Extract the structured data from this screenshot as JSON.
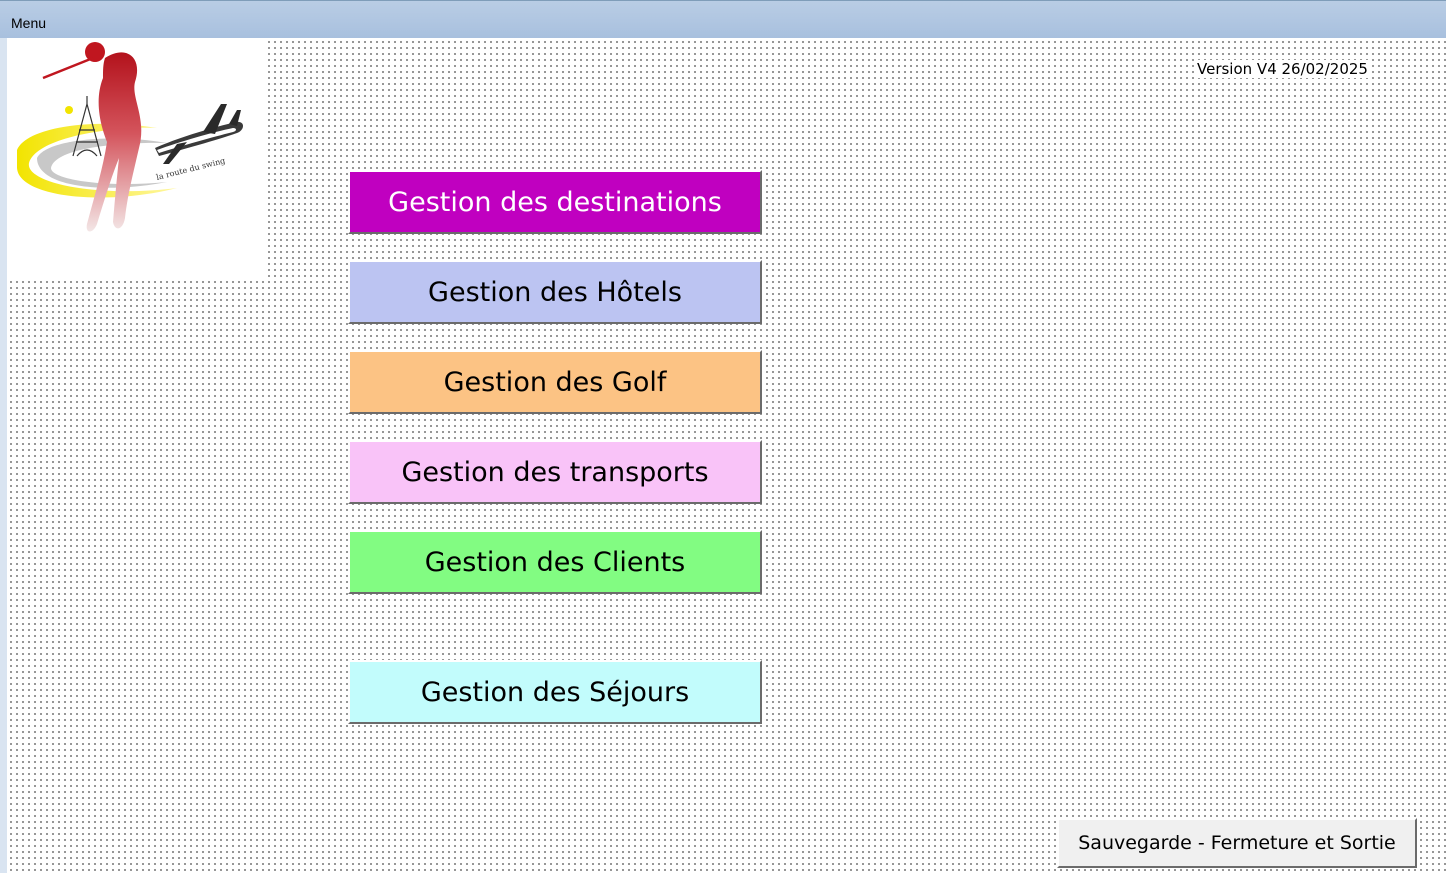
{
  "window": {
    "title": "Menu"
  },
  "version": "Version V4 26/02/2025",
  "logo": {
    "tagline": "la route du swing",
    "icon": "golfer-airplane-eiffel-logo"
  },
  "menu": {
    "destinations": {
      "label": "Gestion des destinations",
      "color": "#c000c0",
      "text_color": "#ffffff"
    },
    "hotels": {
      "label": "Gestion des Hôtels",
      "color": "#bcc4f2",
      "text_color": "#000000"
    },
    "golf": {
      "label": "Gestion des Golf",
      "color": "#fcc384",
      "text_color": "#000000"
    },
    "transports": {
      "label": "Gestion des transports",
      "color": "#f9c3f8",
      "text_color": "#000000"
    },
    "clients": {
      "label": "Gestion des Clients",
      "color": "#82fc82",
      "text_color": "#000000"
    },
    "sejours": {
      "label": "Gestion des Séjours",
      "color": "#c2fcfc",
      "text_color": "#000000"
    }
  },
  "exit_button": {
    "label": "Sauvegarde - Fermeture et Sortie"
  }
}
